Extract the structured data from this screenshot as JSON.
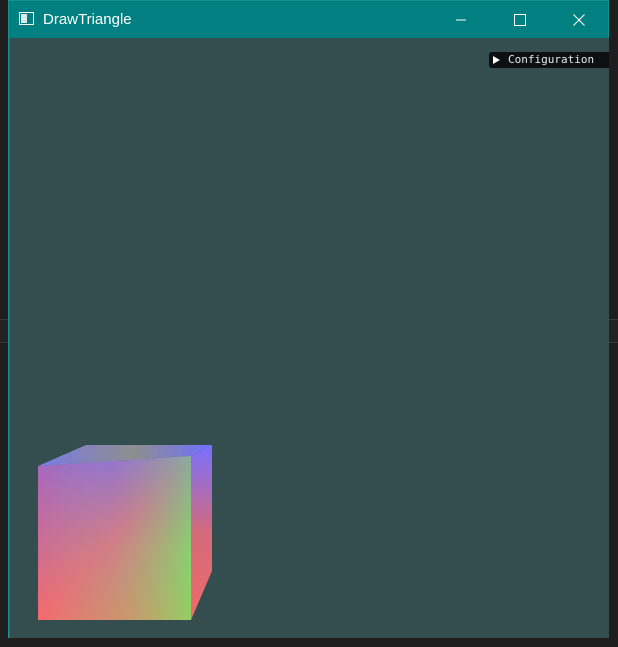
{
  "window": {
    "title": "DrawTriangle",
    "icon": "app-window-icon",
    "controls": {
      "minimize_icon": "minimize-icon",
      "maximize_icon": "maximize-icon",
      "close_icon": "close-icon"
    },
    "titlebar_color": "#008080"
  },
  "viewport": {
    "background_color": "#344e4f"
  },
  "config_panel": {
    "label": "Configuration",
    "collapsed": true,
    "arrow_icon": "triangle-right-icon"
  },
  "scene": {
    "object": "rgb-cube",
    "colors": {
      "red": "#ff6b6b",
      "green": "#6bff6b",
      "blue": "#6b6bff"
    }
  }
}
